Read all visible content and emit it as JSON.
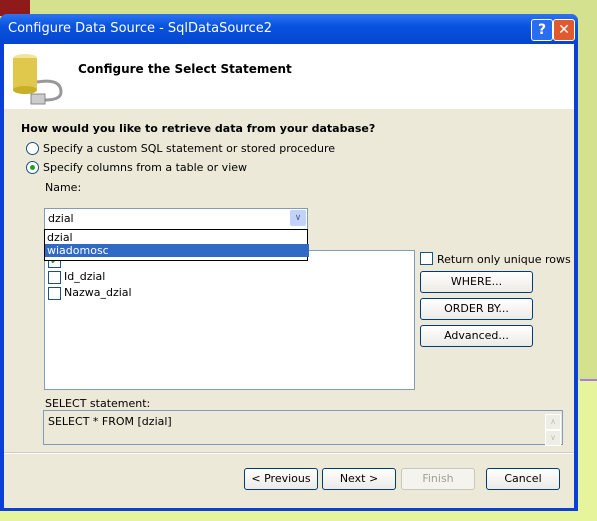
{
  "window": {
    "title": "Configure Data Source - SqlDataSource2",
    "help": "?",
    "close": "✕"
  },
  "header": {
    "title": "Configure the Select Statement"
  },
  "question": "How would you like to retrieve data from your database?",
  "options": [
    {
      "label": "Specify a custom SQL statement or stored procedure",
      "selected": false
    },
    {
      "label": "Specify columns from a table or view",
      "selected": true
    }
  ],
  "name_label": "Name:",
  "name_value": "dzial",
  "dropdown_items": [
    {
      "label": "dzial",
      "selected": false
    },
    {
      "label": "wiadomosc",
      "selected": true
    }
  ],
  "columns": [
    {
      "label": "*",
      "checked": true
    },
    {
      "label": "Id_dzial",
      "checked": false
    },
    {
      "label": "Nazwa_dzial",
      "checked": false
    }
  ],
  "unique_rows": {
    "label": "Return only unique rows",
    "checked": false
  },
  "side_buttons": {
    "where": "WHERE...",
    "order_by": "ORDER BY...",
    "advanced": "Advanced..."
  },
  "select_label": "SELECT statement:",
  "select_statement": "SELECT * FROM [dzial]",
  "footer": {
    "previous": "< Previous",
    "next": "Next >",
    "finish": "Finish",
    "cancel": "Cancel"
  }
}
